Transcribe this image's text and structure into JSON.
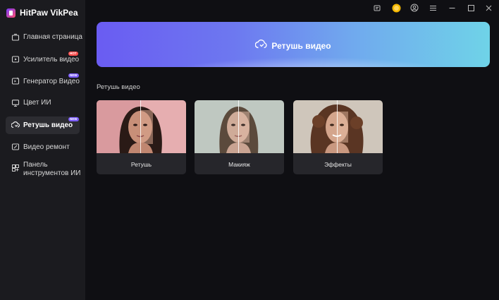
{
  "app": {
    "title": "HitPaw VikPea"
  },
  "sidebar": {
    "items": [
      {
        "label": "Главная страница",
        "icon": "home-icon"
      },
      {
        "label": "Усилитель видео",
        "icon": "video-enhancer-icon",
        "badge": "HOT"
      },
      {
        "label": "Генератор Видео",
        "icon": "video-generator-icon",
        "badge": "NEW"
      },
      {
        "label": "Цвет ИИ",
        "icon": "monitor-icon"
      },
      {
        "label": "Ретушь видео",
        "icon": "retouch-icon",
        "badge": "NEW",
        "active": true
      },
      {
        "label": "Видео ремонт",
        "icon": "repair-icon"
      },
      {
        "label": "Панель инструментов ИИ",
        "icon": "toolbox-icon"
      }
    ]
  },
  "titlebar": {
    "icons": [
      "message-icon",
      "coin-icon",
      "account-icon",
      "menu-icon",
      "minimize-icon",
      "maximize-icon",
      "close-icon"
    ]
  },
  "hero": {
    "label": "Ретушь видео",
    "icon": "retouch-icon"
  },
  "section": {
    "title": "Ретушь видео"
  },
  "cards": [
    {
      "label": "Ретушь"
    },
    {
      "label": "Макияж"
    },
    {
      "label": "Эффекты"
    }
  ],
  "colors": {
    "accent": "#7b5cff",
    "hot": "#ff4d4d",
    "sidebar_bg": "#1b1b1f",
    "main_bg": "#0f0f13"
  }
}
